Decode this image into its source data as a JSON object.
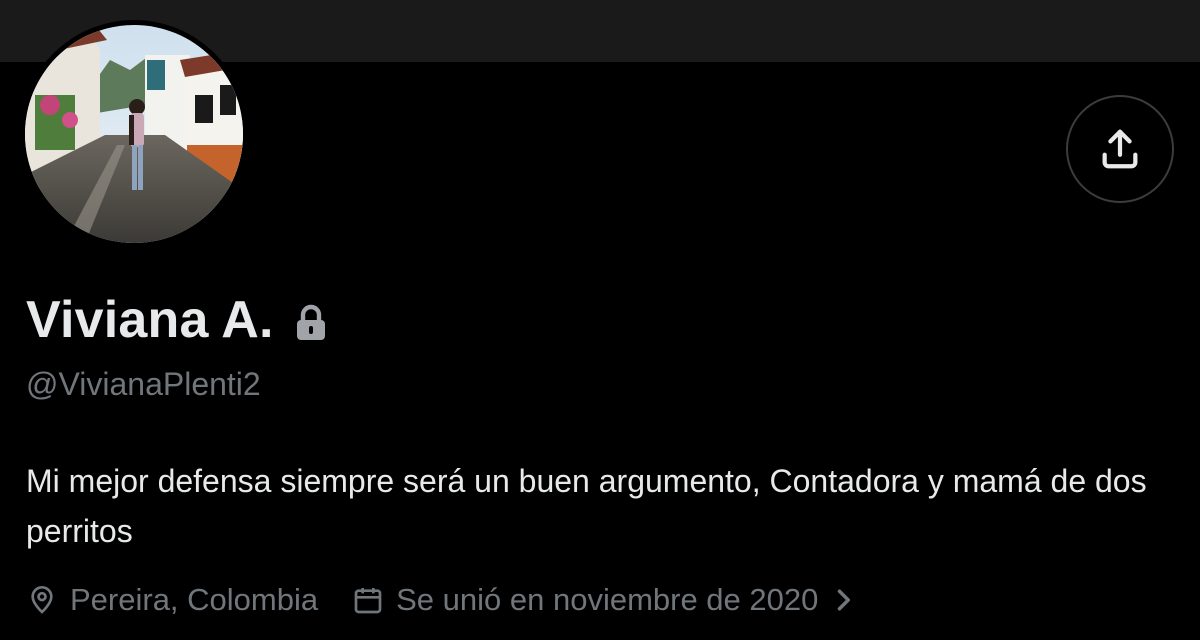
{
  "profile": {
    "display_name": "Viviana A.",
    "handle": "@VivianaPlenti2",
    "protected_icon": "lock-icon",
    "bio": "Mi mejor defensa siempre será un buen argumento, Contadora y mamá de dos perritos",
    "location": "Pereira, Colombia",
    "joined": "Se unió en noviembre de 2020"
  },
  "icons": {
    "share": "share-upload-icon",
    "location": "location-pin-icon",
    "calendar": "calendar-icon",
    "chevron": "chevron-right-icon"
  },
  "colors": {
    "background": "#000000",
    "banner": "#1a1a1a",
    "primary_text": "#e7e9ea",
    "secondary_text": "#71767b",
    "border": "#3a3d40"
  }
}
